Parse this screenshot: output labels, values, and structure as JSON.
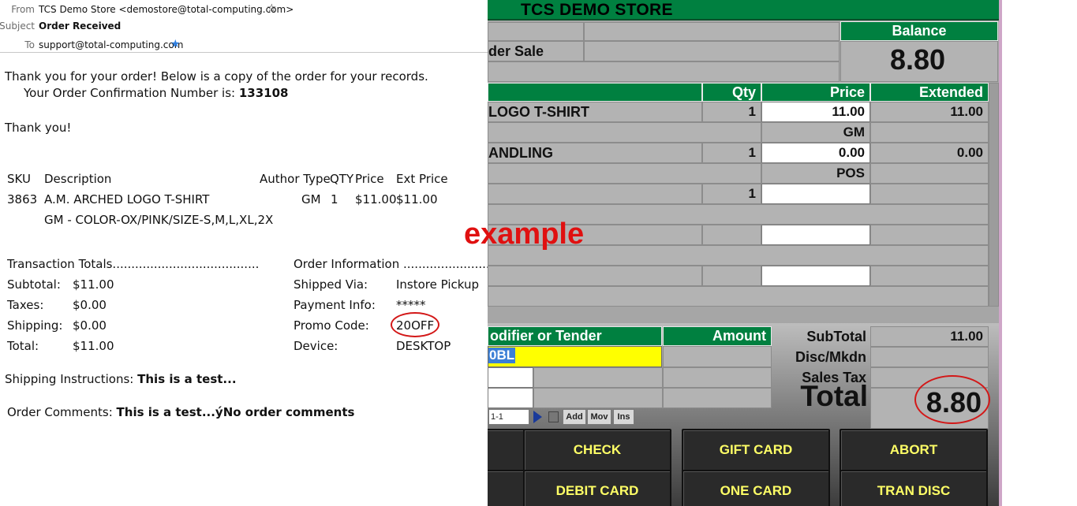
{
  "email": {
    "header": {
      "from_label": "From",
      "from_value": "TCS Demo Store <demostore@total-computing.com>",
      "subject_label": "Subject",
      "subject_value": "Order Received",
      "to_label": "To",
      "to_value": "support@total-computing.com"
    },
    "intro": "Thank you for your order! Below is a copy of the order for your records.",
    "confirmation_label": "Your Order Confirmation Number is:",
    "confirmation_number": "133108",
    "thanks": "Thank you!",
    "items_header": {
      "sku": "SKU",
      "description": "Description",
      "author_type": "Author Type",
      "qty": "QTY",
      "price": "Price",
      "ext_price": "Ext Price"
    },
    "item": {
      "sku": "3863",
      "description": "A.M. ARCHED LOGO T-SHIRT",
      "type": "GM",
      "qty": "1",
      "price": "$11.00",
      "ext_price": "$11.00",
      "options": "GM - COLOR-OX/PINK/SIZE-S,M,L,XL,2X"
    },
    "totals_heading": "Transaction Totals.......................................",
    "order_info_heading": "Order Information ............................",
    "totals": [
      {
        "label": "Subtotal:",
        "value": "$11.00"
      },
      {
        "label": "Taxes:",
        "value": "$0.00"
      },
      {
        "label": "Shipping:",
        "value": "$0.00"
      },
      {
        "label": "Total:",
        "value": "$11.00"
      }
    ],
    "order_info": [
      {
        "label": "Shipped Via:",
        "value": "Instore Pickup"
      },
      {
        "label": "Payment Info:",
        "value": "*****"
      },
      {
        "label": "Promo Code:",
        "value": "20OFF"
      },
      {
        "label": "Device:",
        "value": "DESKTOP"
      }
    ],
    "shipping_instructions_label": "Shipping Instructions:",
    "shipping_instructions_value": "This is a test...",
    "order_comments_label": "Order Comments:",
    "order_comments_value": "This is a test...ýNo order comments"
  },
  "watermark": "example",
  "pos": {
    "store_title": "TCS DEMO STORE",
    "sale_type": "der Sale",
    "balance_label": "Balance",
    "balance_value": "8.80",
    "columns": {
      "qty": "Qty",
      "price": "Price",
      "extended": "Extended"
    },
    "lines": [
      {
        "desc": "LOGO T-SHIRT",
        "qty": "1",
        "price": "11.00",
        "extended": "11.00"
      },
      {
        "sub": "GM"
      },
      {
        "desc": "ANDLING",
        "qty": "1",
        "price": "0.00",
        "extended": "0.00"
      },
      {
        "sub": "POS"
      },
      {
        "qty": "1"
      }
    ],
    "modifier_label": "odifier or Tender",
    "amount_label": "Amount",
    "modifier_value": "0BL",
    "subtotal_label": "SubTotal",
    "subtotal_value": "11.00",
    "disc_label": "Disc/Mkdn",
    "tax_label": "Sales Tax",
    "total_label": "Total",
    "total_value": "8.80",
    "nav": {
      "position": "1-1",
      "add": "Add",
      "mov": "Mov",
      "ins": "Ins"
    },
    "buttons": [
      "CHECK",
      "GIFT CARD",
      "ABORT",
      "DEBIT CARD",
      "ONE CARD",
      "TRAN DISC"
    ],
    "colors": {
      "header_green": "#008040",
      "panel_grey": "#b3b3b3",
      "button_text": "#ffff66",
      "highlight": "#ffff00"
    }
  }
}
